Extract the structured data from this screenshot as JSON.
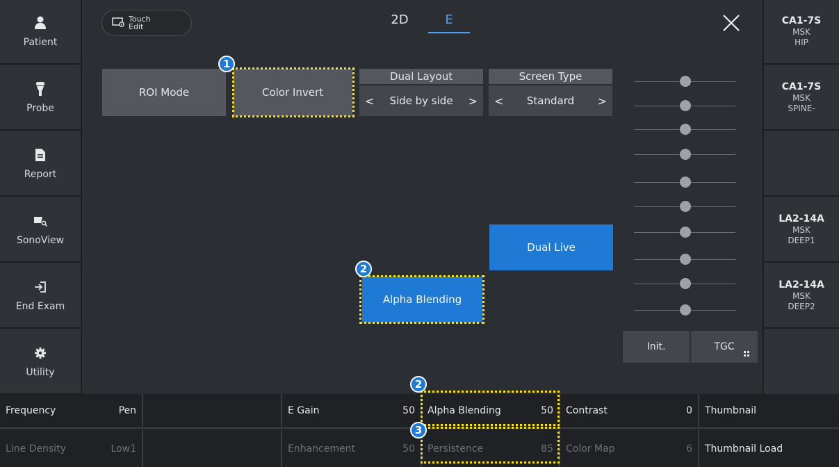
{
  "left_sidebar": [
    {
      "label": "Patient",
      "icon": "person-icon"
    },
    {
      "label": "Probe",
      "icon": "probe-icon"
    },
    {
      "label": "Report",
      "icon": "document-icon"
    },
    {
      "label": "SonoView",
      "icon": "sonoview-icon"
    },
    {
      "label": "End Exam",
      "icon": "exit-icon"
    },
    {
      "label": "Utility",
      "icon": "gear-icon"
    }
  ],
  "right_sidebar": [
    {
      "line1": "CA1-7S",
      "line2": "MSK",
      "line3": "HIP"
    },
    {
      "line1": "CA1-7S",
      "line2": "MSK",
      "line3": "SPINE-"
    },
    {
      "line1": "",
      "line2": "",
      "line3": ""
    },
    {
      "line1": "LA2-14A",
      "line2": "MSK",
      "line3": "DEEP1"
    },
    {
      "line1": "LA2-14A",
      "line2": "MSK",
      "line3": "DEEP2"
    },
    {
      "line1": "",
      "line2": "",
      "line3": ""
    }
  ],
  "touch_edit": {
    "line1": "Touch",
    "line2": "Edit"
  },
  "tabs": {
    "tab1": "2D",
    "tab2": "E",
    "active": "E"
  },
  "buttons": {
    "roi_mode": "ROI Mode",
    "color_invert": "Color Invert",
    "dual_live": "Dual Live",
    "alpha_blending": "Alpha Blending"
  },
  "dual_layout": {
    "header": "Dual Layout",
    "value": "Side by side",
    "prev": "<",
    "next": ">"
  },
  "screen_type": {
    "header": "Screen Type",
    "value": "Standard",
    "prev": "<",
    "next": ">"
  },
  "tgc": {
    "init_label": "Init.",
    "tgc_label": "TGC",
    "slider_count": 10
  },
  "markers": {
    "m1": "1",
    "m2": "2",
    "m2b": "2",
    "m3": "3"
  },
  "bottom_bar": {
    "row1": [
      {
        "name": "Frequency",
        "value": "Pen"
      },
      {
        "name": "",
        "value": ""
      },
      {
        "name": "E Gain",
        "value": "50"
      },
      {
        "name": "Alpha Blending",
        "value": "50"
      },
      {
        "name": "Contrast",
        "value": "0"
      },
      {
        "name": "Thumbnail",
        "value": ""
      }
    ],
    "row2": [
      {
        "name": "Line Density",
        "value": "Low1"
      },
      {
        "name": "",
        "value": ""
      },
      {
        "name": "Enhancement",
        "value": "50"
      },
      {
        "name": "Persistence",
        "value": "85"
      },
      {
        "name": "Color Map",
        "value": "6"
      },
      {
        "name": "Thumbnail Load",
        "value": ""
      }
    ]
  },
  "colors": {
    "accent": "#1f7ad6",
    "highlight": "#f5e21a",
    "tab_active": "#4aa3ff"
  }
}
